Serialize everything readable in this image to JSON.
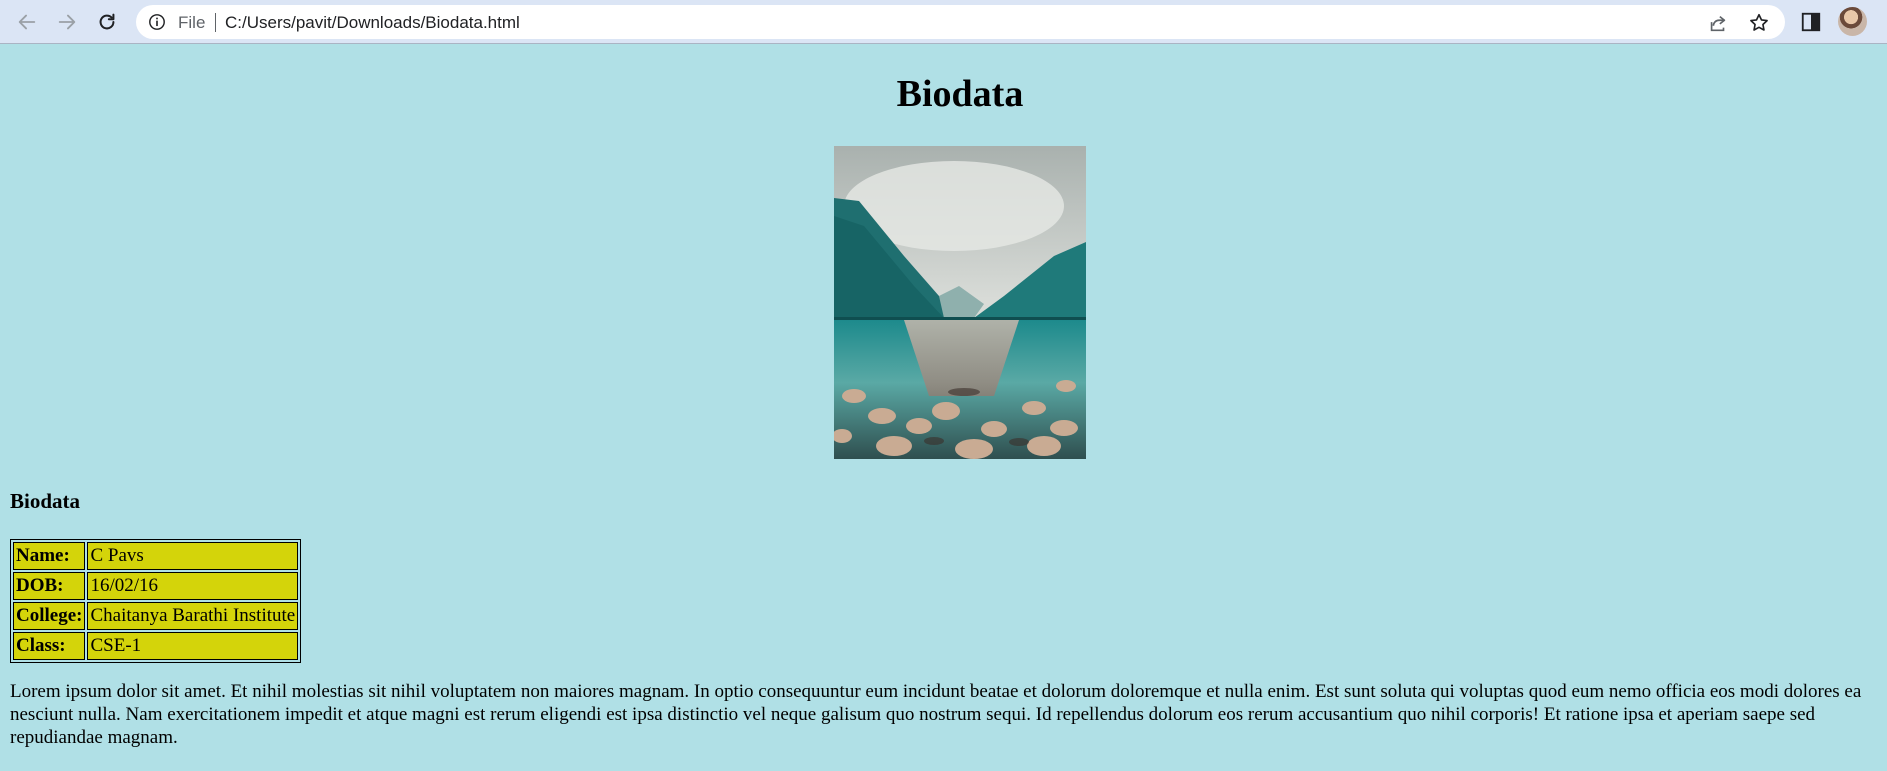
{
  "browser": {
    "scheme_label": "File",
    "url": "C:/Users/pavit/Downloads/Biodata.html"
  },
  "page": {
    "title": "Biodata",
    "section_heading": "Biodata",
    "table": [
      {
        "label": "Name:",
        "value": "C Pavs"
      },
      {
        "label": "DOB:",
        "value": "16/02/16"
      },
      {
        "label": "College:",
        "value": "Chaitanya Barathi Institute"
      },
      {
        "label": "Class:",
        "value": "CSE-1"
      }
    ],
    "paragraph": "Lorem ipsum dolor sit amet. Et nihil molestias sit nihil voluptatem non maiores magnam. In optio consequuntur eum incidunt beatae et dolorum doloremque et nulla enim. Est sunt soluta qui voluptas quod eum nemo officia eos modi dolores ea nesciunt nulla. Nam exercitationem impedit et atque magni est rerum eligendi est ipsa distinctio vel neque galisum quo nostrum sequi. Id repellendus dolorum eos rerum accusantium quo nihil corporis! Et ratione ipsa et aperiam saepe sed repudiandae magnam."
  },
  "icons": {
    "back": "arrow-left-icon",
    "forward": "arrow-right-icon",
    "reload": "reload-icon",
    "info": "info-icon",
    "share": "share-icon",
    "bookmark": "star-icon",
    "side_panel": "side-panel-icon",
    "profile": "avatar"
  },
  "colors": {
    "page_background": "#b0e0e6",
    "table_cell": "#d4d40a",
    "toolbar": "#dbe5f5"
  }
}
